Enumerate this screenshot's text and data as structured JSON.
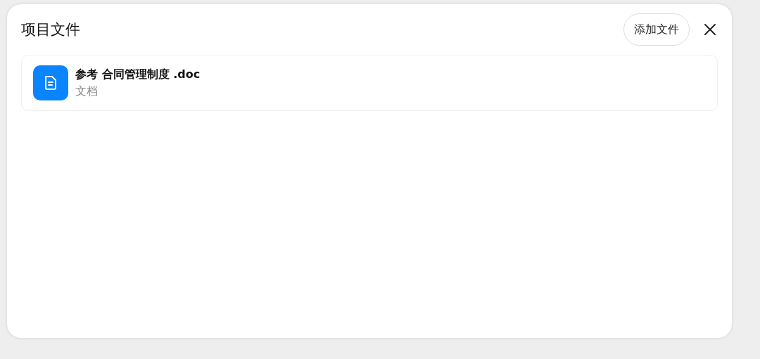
{
  "dialog": {
    "title": "项目文件",
    "add_button": "添加文件",
    "files": [
      {
        "name": "参考 合同管理制度 .doc",
        "type": "文档",
        "kind": "document"
      }
    ]
  }
}
